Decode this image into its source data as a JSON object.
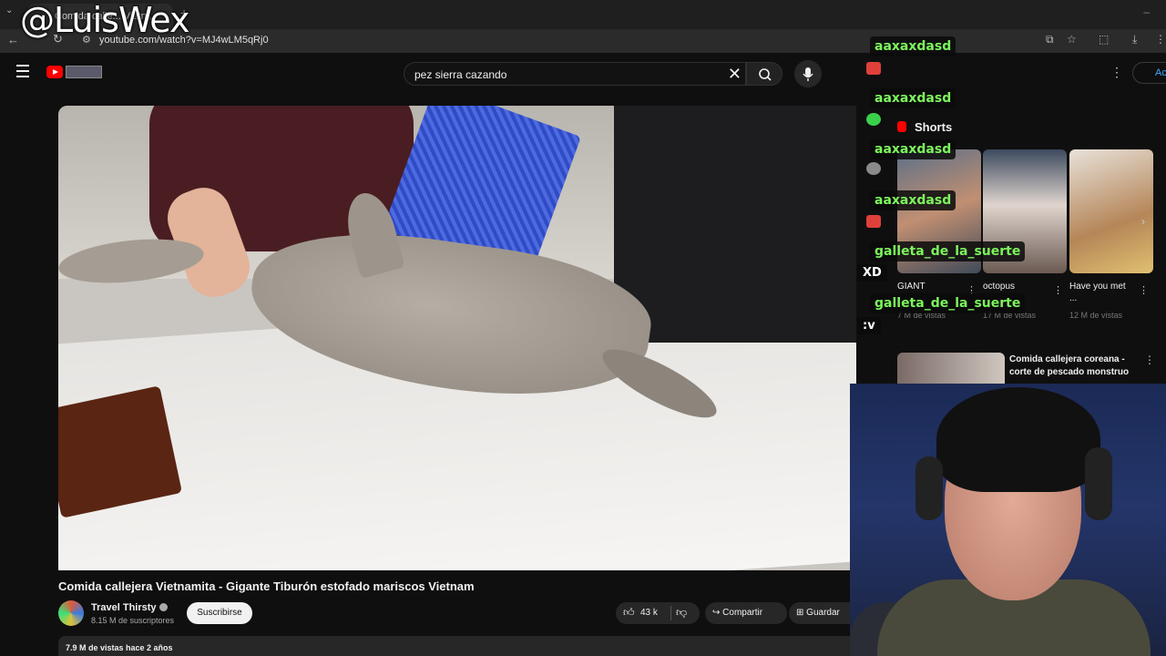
{
  "browser": {
    "tab_title": "Comida calle... Vietn...",
    "url": "youtube.com/watch?v=MJ4wLM5qRj0"
  },
  "watermark": "@LuisWex",
  "header": {
    "search_query": "pez sierra cazando",
    "account_label": "Ac"
  },
  "video": {
    "title": "Comida callejera Vietnamita - Gigante Tiburón estofado mariscos Vietnam",
    "channel": "Travel Thirsty",
    "subscribers": "8.15 M de suscriptores",
    "subscribe_label": "Suscribirse",
    "likes": "43 k",
    "share_label": "Compartir",
    "save_label": "Guardar",
    "views_date": "7.9 M de vistas  hace 2 años"
  },
  "sidebar": {
    "shorts_heading": "Shorts",
    "shorts": [
      {
        "title": "GIANT",
        "views": "7 M de vistas"
      },
      {
        "title": "octopus",
        "views": "17 M de vistas"
      },
      {
        "title": "Have you met ...",
        "views": "12 M de vistas"
      }
    ],
    "related": {
      "title": "Comida callejera coreana - corte de pescado monstruo"
    }
  },
  "chat": [
    {
      "user": "aaxaxdasd",
      "emote_color": "#e0403a"
    },
    {
      "user": "aaxaxdasd",
      "emote_color": "#3ad04a"
    },
    {
      "user": "aaxaxdasd",
      "emote_color": "#8a8a8a"
    },
    {
      "user": "aaxaxdasd",
      "emote_color": "#e0403a"
    },
    {
      "user": "galleta_de_la_suerte",
      "message": "XD"
    },
    {
      "user": "galleta_de_la_suerte",
      "message": ":v"
    }
  ],
  "colors": {
    "chat_name": "#7cf55c",
    "yt_red": "#ff0000",
    "link_blue": "#3ea6ff"
  }
}
